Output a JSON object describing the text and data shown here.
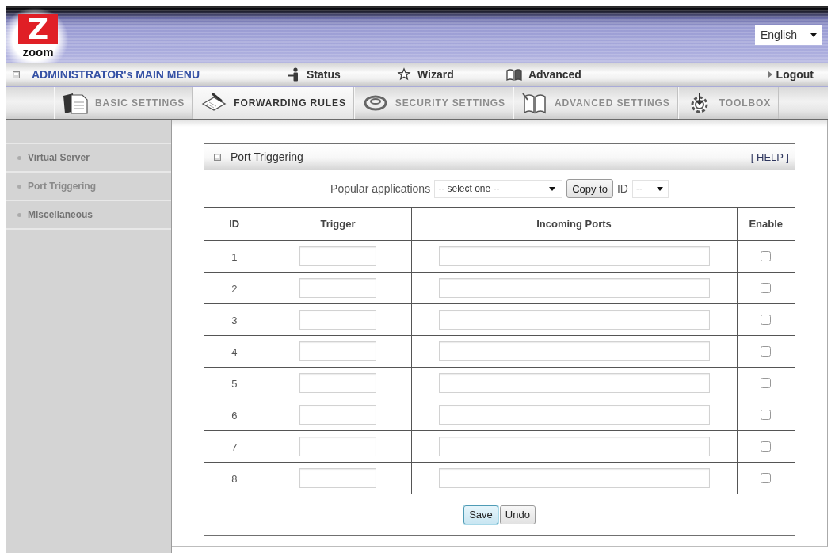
{
  "header": {
    "logo": {
      "mark": "Z",
      "wordmark": "zoom"
    },
    "language_select": {
      "value": "English"
    }
  },
  "menu_bar": {
    "title": "ADMINISTRATOR's MAIN MENU",
    "links": [
      {
        "label": "Status"
      },
      {
        "label": "Wizard"
      },
      {
        "label": "Advanced"
      }
    ],
    "logout": "Logout"
  },
  "tabs": [
    {
      "label": "BASIC SETTINGS",
      "selected": false
    },
    {
      "label": "FORWARDING RULES",
      "selected": true
    },
    {
      "label": "SECURITY SETTINGS",
      "selected": false
    },
    {
      "label": "ADVANCED SETTINGS",
      "selected": false
    },
    {
      "label": "TOOLBOX",
      "selected": false
    }
  ],
  "sidebar": {
    "items": [
      {
        "label": "Virtual Server",
        "selected": false
      },
      {
        "label": "Port Triggering",
        "selected": true
      },
      {
        "label": "Miscellaneous",
        "selected": false
      }
    ]
  },
  "panel": {
    "title": "Port Triggering",
    "help": "[ HELP ]",
    "popular_applications": {
      "label": "Popular applications",
      "select": {
        "value": "-- select one --"
      },
      "copy_button": "Copy to",
      "id_label": "ID",
      "id_select": {
        "value": "--"
      }
    },
    "table": {
      "columns": [
        "ID",
        "Trigger",
        "Incoming Ports",
        "Enable"
      ],
      "rows": [
        {
          "id": "1",
          "checked": false
        },
        {
          "id": "2",
          "checked": false
        },
        {
          "id": "3",
          "checked": false
        },
        {
          "id": "4",
          "checked": false
        },
        {
          "id": "5",
          "checked": false
        },
        {
          "id": "6",
          "checked": false
        },
        {
          "id": "7",
          "checked": false
        },
        {
          "id": "8",
          "checked": false
        }
      ]
    },
    "buttons": [
      {
        "label": "Save",
        "focused": true
      },
      {
        "label": "Undo",
        "focused": false
      }
    ]
  }
}
